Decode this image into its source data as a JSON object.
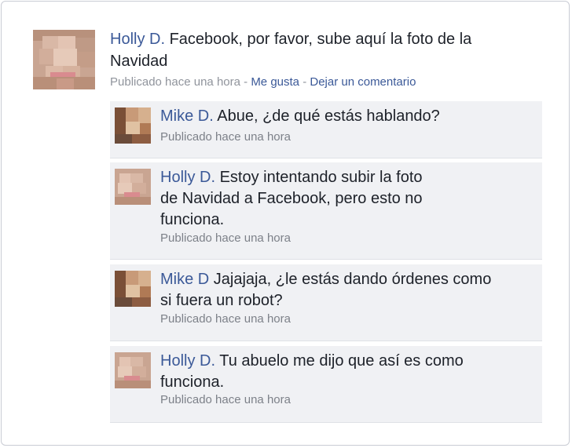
{
  "post": {
    "author": "Holly D.",
    "text": "Facebook, por favor, sube aquí la foto de la Navidad",
    "timestamp": "Publicado hace una hora",
    "separator": "-",
    "like_label": "Me gusta",
    "comment_label": "Dejar un comentario"
  },
  "comments": [
    {
      "author": "Mike D.",
      "text": "Abue, ¿de qué estás hablando?",
      "timestamp": "Publicado hace una hora"
    },
    {
      "author": "Holly D.",
      "text": "Estoy intentando subir la foto de Navidad a Facebook, pero esto no funciona.",
      "timestamp": "Publicado hace una hora"
    },
    {
      "author": "Mike D",
      "text": "Jajajaja, ¿le estás dando órdenes como si fuera un robot?",
      "timestamp": "Publicado hace una hora"
    },
    {
      "author": "Holly D.",
      "text": "Tu abuelo me dijo que así es como funciona.",
      "timestamp": "Publicado hace una hora"
    }
  ],
  "colors": {
    "name_link": "#3b5998",
    "comment_bg": "#f0f1f4",
    "meta_text": "#90949c"
  }
}
